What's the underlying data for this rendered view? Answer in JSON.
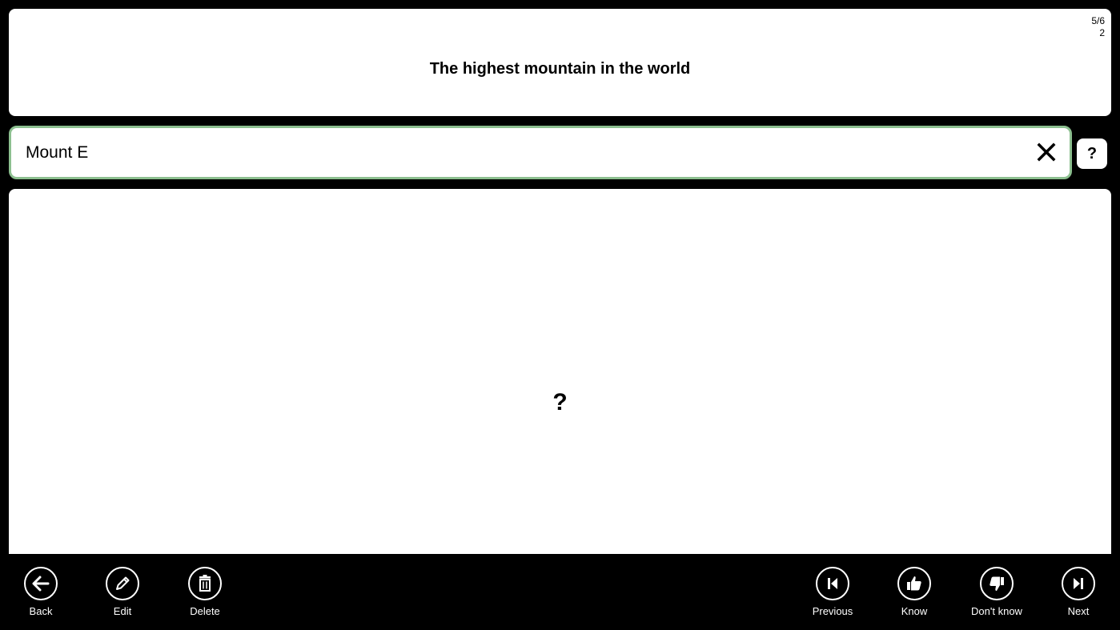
{
  "question": {
    "text": "The highest mountain in the world",
    "counter_position": "5/6",
    "counter_sub": "2"
  },
  "answer": {
    "value": "Mount E",
    "placeholder": "",
    "hint_label": "?",
    "reveal_placeholder": "?"
  },
  "app_bar": {
    "left": [
      {
        "label": "Back",
        "icon": "arrow-left-icon"
      },
      {
        "label": "Edit",
        "icon": "pencil-icon"
      },
      {
        "label": "Delete",
        "icon": "trash-icon"
      }
    ],
    "right": [
      {
        "label": "Previous",
        "icon": "skip-previous-icon"
      },
      {
        "label": "Know",
        "icon": "thumbs-up-icon"
      },
      {
        "label": "Don't know",
        "icon": "thumbs-down-icon"
      },
      {
        "label": "Next",
        "icon": "skip-next-icon"
      }
    ]
  },
  "colors": {
    "background": "#000000",
    "card": "#ffffff",
    "input_border": "#8cbf8f"
  }
}
